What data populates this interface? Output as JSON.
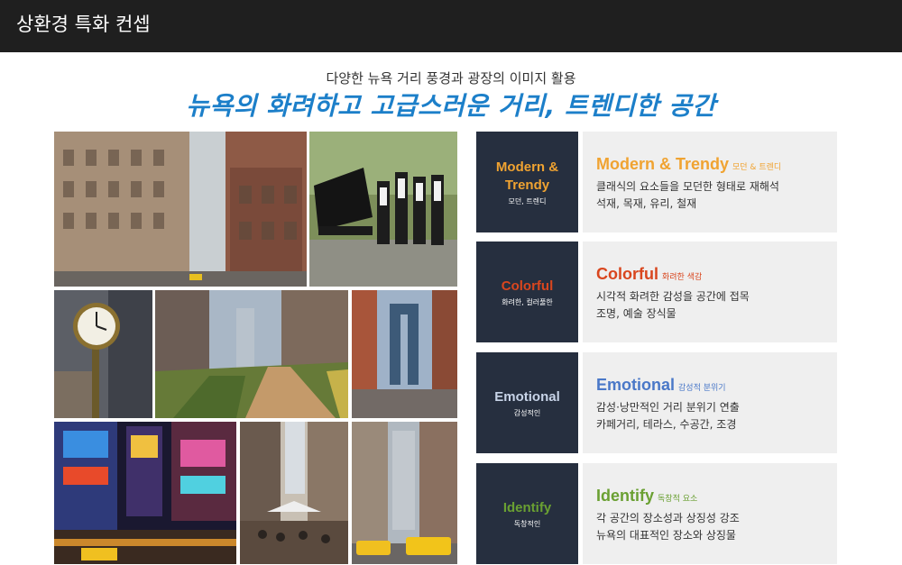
{
  "header": {
    "title": "상환경 특화 컨셉"
  },
  "subtitle": "다양한 뉴욕 거리 풍경과 광장의 이미지 활용",
  "headline": "뉴욕의 화려하고 고급스러운 거리, 트렌디한 공간",
  "concepts": [
    {
      "key": "Modern & Trendy",
      "sub": "모던, 트렌디",
      "title": "Modern & Trendy",
      "title_sub": "모던 & 트렌디",
      "line1": "클래식의 요소들을 모던한 형태로 재해석",
      "line2": "석재, 목재, 유리, 철재",
      "color": "#f0a331"
    },
    {
      "key": "Colorful",
      "sub": "화려한, 컬러풀한",
      "title": "Colorful",
      "title_sub": "화려한 색감",
      "line1": "시각적 화려한 감성을 공간에 접목",
      "line2": "조명, 예술 장식물",
      "color": "#d9461e"
    },
    {
      "key": "Emotional",
      "sub": "감성적인",
      "title": "Emotional",
      "title_sub": "감성적 분위기",
      "line1": "감성·낭만적인 거리 분위기 연출",
      "line2": "카페거리, 테라스, 수공간, 조경",
      "color": "#4a78c8"
    },
    {
      "key": "Identify",
      "sub": "독창적인",
      "title": "Identify",
      "title_sub": "독창적 요소",
      "line1": "각 공간의 장소성과 상징성 강조",
      "line2": "뉴욕의 대표적인 장소와 상징물",
      "color": "#6aa032"
    }
  ],
  "photos": [
    {
      "name": "photo-wall-street-buildings"
    },
    {
      "name": "photo-street-band-piano"
    },
    {
      "name": "photo-street-clock"
    },
    {
      "name": "photo-high-line-park"
    },
    {
      "name": "photo-manhattan-bridge"
    },
    {
      "name": "photo-times-square-night"
    },
    {
      "name": "photo-cafe-street"
    },
    {
      "name": "photo-yellow-taxi-street"
    }
  ]
}
